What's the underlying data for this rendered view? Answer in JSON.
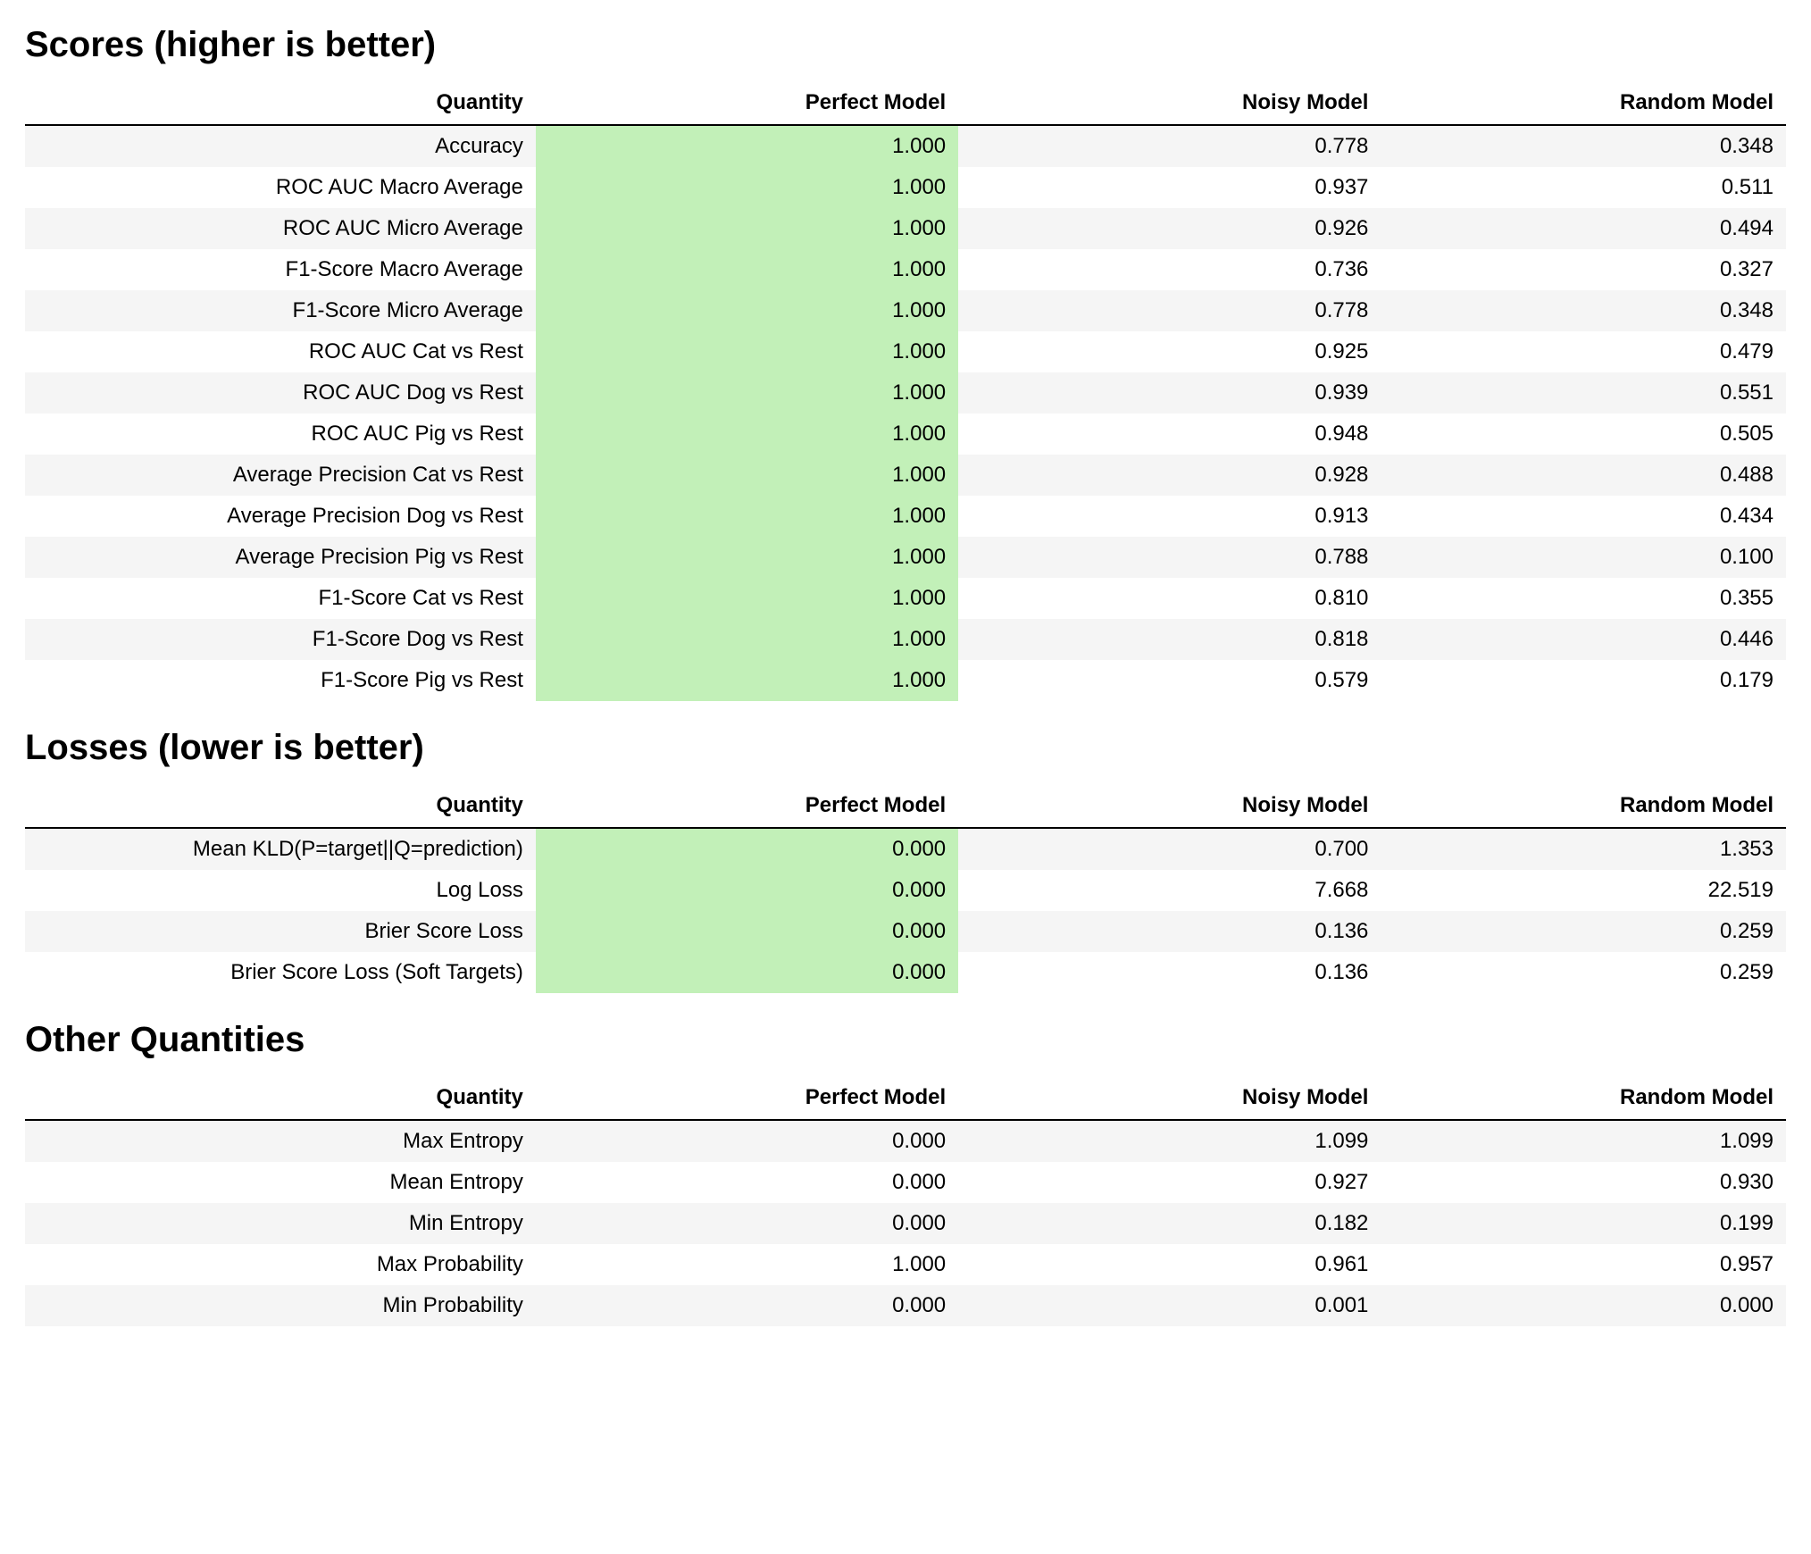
{
  "sections": [
    {
      "title": "Scores (higher is better)",
      "headers": [
        "Quantity",
        "Perfect Model",
        "Noisy Model",
        "Random Model"
      ],
      "highlight_col": 1,
      "rows": [
        [
          "Accuracy",
          "1.000",
          "0.778",
          "0.348"
        ],
        [
          "ROC AUC Macro Average",
          "1.000",
          "0.937",
          "0.511"
        ],
        [
          "ROC AUC Micro Average",
          "1.000",
          "0.926",
          "0.494"
        ],
        [
          "F1-Score Macro Average",
          "1.000",
          "0.736",
          "0.327"
        ],
        [
          "F1-Score Micro Average",
          "1.000",
          "0.778",
          "0.348"
        ],
        [
          "ROC AUC Cat vs Rest",
          "1.000",
          "0.925",
          "0.479"
        ],
        [
          "ROC AUC Dog vs Rest",
          "1.000",
          "0.939",
          "0.551"
        ],
        [
          "ROC AUC Pig vs Rest",
          "1.000",
          "0.948",
          "0.505"
        ],
        [
          "Average Precision Cat vs Rest",
          "1.000",
          "0.928",
          "0.488"
        ],
        [
          "Average Precision Dog vs Rest",
          "1.000",
          "0.913",
          "0.434"
        ],
        [
          "Average Precision Pig vs Rest",
          "1.000",
          "0.788",
          "0.100"
        ],
        [
          "F1-Score Cat vs Rest",
          "1.000",
          "0.810",
          "0.355"
        ],
        [
          "F1-Score Dog vs Rest",
          "1.000",
          "0.818",
          "0.446"
        ],
        [
          "F1-Score Pig vs Rest",
          "1.000",
          "0.579",
          "0.179"
        ]
      ]
    },
    {
      "title": "Losses (lower is better)",
      "headers": [
        "Quantity",
        "Perfect Model",
        "Noisy Model",
        "Random Model"
      ],
      "highlight_col": 1,
      "rows": [
        [
          "Mean KLD(P=target||Q=prediction)",
          "0.000",
          "0.700",
          "1.353"
        ],
        [
          "Log Loss",
          "0.000",
          "7.668",
          "22.519"
        ],
        [
          "Brier Score Loss",
          "0.000",
          "0.136",
          "0.259"
        ],
        [
          "Brier Score Loss (Soft Targets)",
          "0.000",
          "0.136",
          "0.259"
        ]
      ]
    },
    {
      "title": "Other Quantities",
      "headers": [
        "Quantity",
        "Perfect Model",
        "Noisy Model",
        "Random Model"
      ],
      "highlight_col": null,
      "rows": [
        [
          "Max Entropy",
          "0.000",
          "1.099",
          "1.099"
        ],
        [
          "Mean Entropy",
          "0.000",
          "0.927",
          "0.930"
        ],
        [
          "Min Entropy",
          "0.000",
          "0.182",
          "0.199"
        ],
        [
          "Max Probability",
          "1.000",
          "0.961",
          "0.957"
        ],
        [
          "Min Probability",
          "0.000",
          "0.001",
          "0.000"
        ]
      ]
    }
  ]
}
